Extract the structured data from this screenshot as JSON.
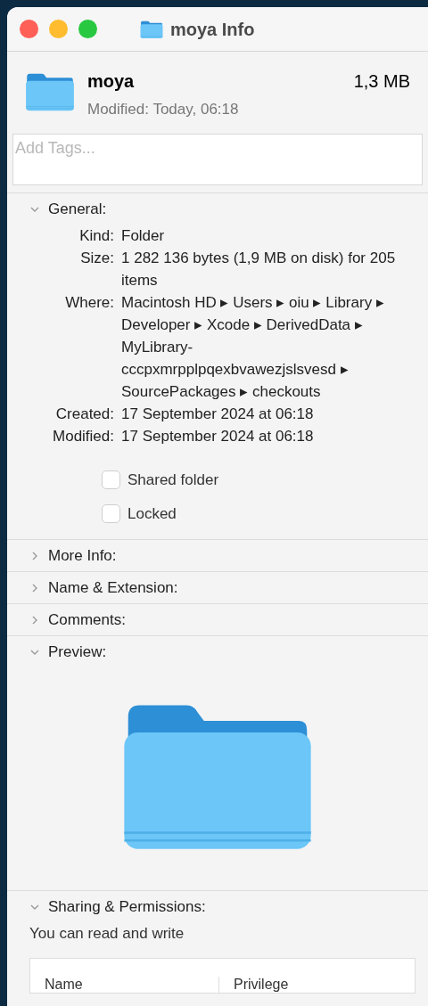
{
  "window": {
    "title": "moya Info"
  },
  "header": {
    "name": "moya",
    "size": "1,3 MB",
    "modified": "Modified: Today, 06:18"
  },
  "tags": {
    "placeholder": "Add Tags..."
  },
  "sections": [
    {
      "kind": "general",
      "title": "General:",
      "expanded": true,
      "rows": [
        {
          "label": "Kind:",
          "value": "Folder"
        },
        {
          "label": "Size:",
          "value": "1 282 136 bytes (1,9 MB on disk) for 205 items"
        },
        {
          "label": "Where:",
          "value": "Macintosh HD ▸ Users ▸ oiu ▸ Library ▸ Developer ▸ Xcode ▸ DerivedData ▸ MyLibrary-cccpxmrpplpqexbvawezjslsvesd ▸ SourcePackages ▸ checkouts"
        },
        {
          "label": "Created:",
          "value": "17 September 2024 at 06:18"
        },
        {
          "label": "Modified:",
          "value": "17 September 2024 at 06:18"
        }
      ],
      "checkboxes": [
        {
          "label": "Shared folder",
          "checked": false
        },
        {
          "label": "Locked",
          "checked": false
        }
      ]
    },
    {
      "title": "More Info:",
      "expanded": false
    },
    {
      "title": "Name & Extension:",
      "expanded": false
    },
    {
      "title": "Comments:",
      "expanded": false
    },
    {
      "kind": "preview",
      "title": "Preview:",
      "expanded": true
    },
    {
      "kind": "sharing",
      "title": "Sharing & Permissions:",
      "expanded": true,
      "summary": "You can read and write",
      "columns": [
        "Name",
        "Privilege"
      ]
    }
  ]
}
